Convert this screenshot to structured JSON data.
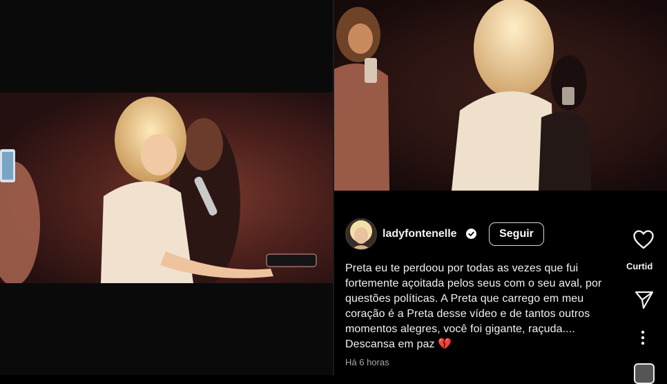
{
  "post": {
    "username": "ladyfontenelle",
    "follow_label": "Seguir",
    "caption": "Preta eu te perdoou por todas as vezes que fui fortemente açoitada pelos seus com o seu aval, por questões políticas. A Preta que carrego em meu coração é a Preta desse vídeo e de tantos outros momentos alegres, você foi gigante, raçuda.... Descansa em paz 💔",
    "timestamp": "Há 6 horas"
  },
  "actions": {
    "like_label": "Curtid"
  },
  "icons": {
    "verified": "verified-badge-icon",
    "like": "heart-icon",
    "share": "send-icon",
    "more": "more-vertical-icon"
  },
  "colors": {
    "background": "#000000",
    "text": "#f2f2f2",
    "muted": "#a8a8a8",
    "broken_heart": "#e0245e"
  }
}
